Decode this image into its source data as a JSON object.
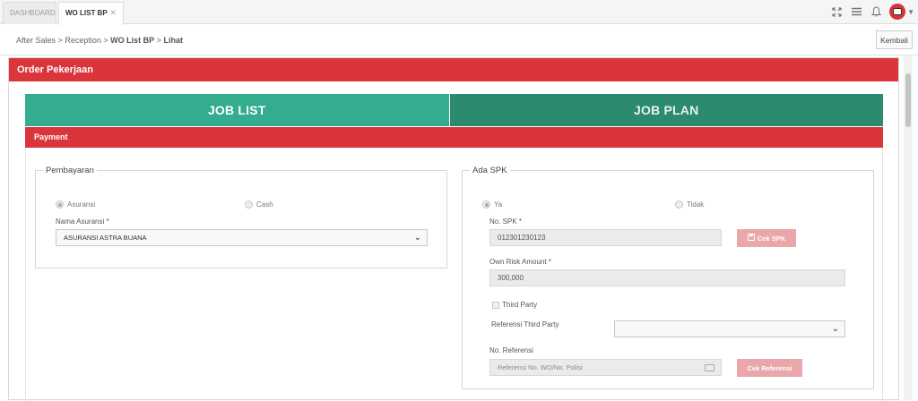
{
  "tabs": {
    "dashboard": "DASHBOARD",
    "active": "WO LIST BP",
    "close": "✕"
  },
  "icons": {
    "fullscreen": "fullscreen-icon",
    "menu": "menu-icon",
    "bell": "bell-icon",
    "avatar": "avatar-icon",
    "chevron": "chevron-down-icon"
  },
  "breadcrumb": {
    "items": [
      "After Sales",
      "Reception",
      "WO List BP",
      "Lihat"
    ],
    "separator": ">"
  },
  "kembali_label": "Kembali",
  "panel_title": "Order Pekerjaan",
  "job_tabs": {
    "list": "JOB LIST",
    "plan": "JOB PLAN"
  },
  "payment_label": "Payment",
  "pembayaran": {
    "legend": "Pembayaran",
    "option_asuransi": "Asuransi",
    "option_cash": "Cash",
    "selected": "Asuransi",
    "nama_asuransi_label": "Nama Asuransi *",
    "nama_asuransi_value": "ASURANSI ASTRA BUANA"
  },
  "ada_spk": {
    "legend": "Ada SPK",
    "option_ya": "Ya",
    "option_tidak": "Tidak",
    "selected": "Ya",
    "no_spk_label": "No. SPK *",
    "no_spk_value": "012301230123",
    "cek_spk_label": "Cek SPK",
    "own_risk_label": "Own Risk Amount *",
    "own_risk_value": "300,000",
    "third_party_label": "Third Party",
    "referensi_third_party_label": "Referensi Third Party",
    "referensi_third_party_value": "",
    "no_referensi_label": "No. Referensi",
    "no_referensi_placeholder": "Referensi No. WO/No. Polisi",
    "cek_referensi_label": "Cek Referensi"
  },
  "colors": {
    "header_red": "#d9353b",
    "job_list": "#33ac8f",
    "job_plan": "#2c8a6e",
    "disabled_button": "#eaa7aa"
  }
}
